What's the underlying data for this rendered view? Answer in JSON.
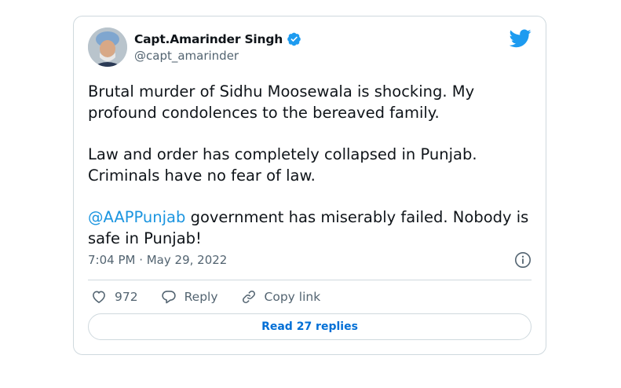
{
  "author": {
    "display_name": "Capt.Amarinder Singh",
    "handle": "@capt_amarinder",
    "verified": true
  },
  "tweet": {
    "paragraphs": [
      "Brutal murder of Sidhu Moosewala is shocking. My profound condolences to the bereaved family.",
      "Law and order has completely collapsed in Punjab. Criminals have no fear of law."
    ],
    "mention": "@AAPPunjab",
    "mention_followup": " government has miserably failed. Nobody is safe in Punjab!",
    "timestamp": "7:04 PM · May 29, 2022"
  },
  "actions": {
    "like_count": "972",
    "reply_label": "Reply",
    "copy_link_label": "Copy link"
  },
  "read_replies_label": "Read 27 replies",
  "icons": {
    "brand": "twitter-bird-icon",
    "verified": "verified-badge-icon",
    "info": "info-icon",
    "like": "heart-icon",
    "reply": "speech-bubble-icon",
    "copy_link": "link-icon"
  },
  "colors": {
    "brand": "#1d9bf0",
    "mention": "#1b95e0",
    "secondary_text": "#536471",
    "border": "#cfd9de",
    "button_text": "#006fd6"
  }
}
